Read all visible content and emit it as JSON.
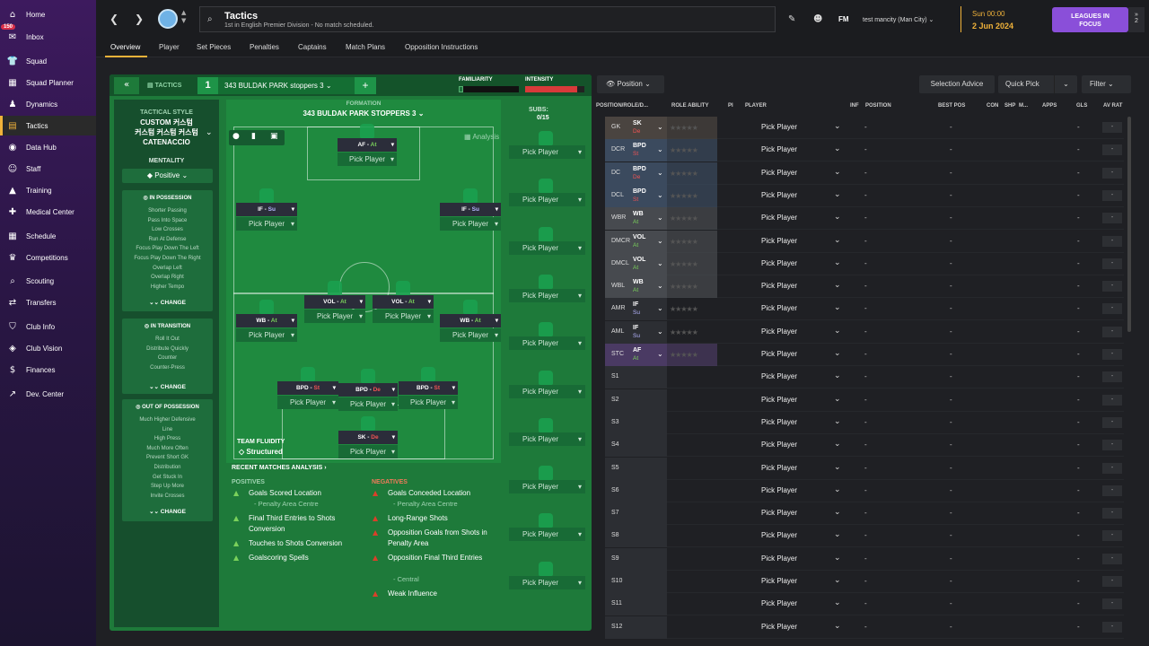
{
  "sidebar": {
    "items": [
      {
        "label": "Home",
        "icon": "home-icon",
        "glyph": "⌂"
      },
      {
        "label": "Inbox",
        "icon": "inbox-icon",
        "glyph": "✉",
        "badge": "150"
      },
      {
        "label": "Squad",
        "icon": "squad-icon",
        "glyph": "👕"
      },
      {
        "label": "Squad Planner",
        "icon": "squad-planner-icon",
        "glyph": "▦"
      },
      {
        "label": "Dynamics",
        "icon": "dynamics-icon",
        "glyph": "♟"
      },
      {
        "label": "Tactics",
        "icon": "tactics-icon",
        "glyph": "▤"
      },
      {
        "label": "Data Hub",
        "icon": "data-hub-icon",
        "glyph": "◉"
      },
      {
        "label": "Staff",
        "icon": "staff-icon",
        "glyph": "☺"
      },
      {
        "label": "Training",
        "icon": "training-icon",
        "glyph": "▲"
      },
      {
        "label": "Medical Center",
        "icon": "medical-icon",
        "glyph": "✚"
      },
      {
        "label": "Schedule",
        "icon": "schedule-icon",
        "glyph": "▦"
      },
      {
        "label": "Competitions",
        "icon": "trophy-icon",
        "glyph": "♛"
      },
      {
        "label": "Scouting",
        "icon": "scouting-icon",
        "glyph": "⌕"
      },
      {
        "label": "Transfers",
        "icon": "transfers-icon",
        "glyph": "⇄"
      },
      {
        "label": "Club Info",
        "icon": "club-info-icon",
        "glyph": "⛉"
      },
      {
        "label": "Club Vision",
        "icon": "club-vision-icon",
        "glyph": "◈"
      },
      {
        "label": "Finances",
        "icon": "finances-icon",
        "glyph": "$"
      },
      {
        "label": "Dev. Center",
        "icon": "dev-center-icon",
        "glyph": "↗"
      }
    ]
  },
  "header": {
    "title": "Tactics",
    "subtitle": "1st in English Premier Division - No match scheduled.",
    "fm_label": "FM",
    "profile": "test mancity (Man City)",
    "date_line1": "Sun 00:00",
    "date_line2": "2 Jun 2024",
    "leagues_btn": "LEAGUES IN FOCUS",
    "leagues_count": "2"
  },
  "tabs": [
    "Overview",
    "Player",
    "Set Pieces",
    "Penalties",
    "Captains",
    "Match Plans",
    "Opposition Instructions"
  ],
  "tactic": {
    "label": "TACTICS",
    "slot": "1",
    "name": "343 BULDAK PARK stoppers 3",
    "familiarity_label": "FAMILIARITY",
    "familiarity_value": 0.08,
    "intensity_label": "INTENSITY",
    "intensity_value": 0.88,
    "formation_label": "FORMATION",
    "formation_name": "343 BULDAK PARK STOPPERS 3",
    "subs_label": "SUBS:",
    "subs_count": "0/15",
    "analysis_label": "Analysis"
  },
  "style": {
    "header": "TACTICAL STYLE",
    "name_line1": "CUSTOM 커스텀",
    "name_line2": "커스텀 커스텀 커스텀",
    "name_line3": "CATENACCIO",
    "mentality_label": "MENTALITY",
    "mentality_value": "Positive",
    "in_possession": {
      "title": "IN POSSESSION",
      "items": [
        "Shorter Passing",
        "Pass Into Space",
        "Low Crosses",
        "Run At Defense",
        "Focus Play Down The Left",
        "Focus Play Down The Right",
        "Overlap Left",
        "Overlap Right",
        "Higher Tempo"
      ],
      "change": "CHANGE"
    },
    "in_transition": {
      "title": "IN TRANSITION",
      "items": [
        "Roll It Out",
        "Distribute Quickly",
        "Counter",
        "Counter-Press"
      ],
      "change": "CHANGE"
    },
    "out_of_possession": {
      "title": "OUT OF POSSESSION",
      "items": [
        "Much Higher Defensive",
        "Line",
        "High Press",
        "Much More Often",
        "Prevent Short GK",
        "Distribution",
        "Get Stuck In",
        "Step Up More",
        "Invite Crosses"
      ],
      "change": "CHANGE"
    }
  },
  "pitch_players": [
    {
      "role": "AF",
      "duty": "At",
      "duty_type": "a",
      "pick": "Pick Player"
    },
    {
      "role": "IF",
      "duty": "Su",
      "duty_type": "s",
      "pick": "Pick Player"
    },
    {
      "role": "IF",
      "duty": "Su",
      "duty_type": "s",
      "pick": "Pick Player"
    },
    {
      "role": "VOL",
      "duty": "At",
      "duty_type": "a",
      "pick": "Pick Player"
    },
    {
      "role": "VOL",
      "duty": "At",
      "duty_type": "a",
      "pick": "Pick Player"
    },
    {
      "role": "WB",
      "duty": "At",
      "duty_type": "a",
      "pick": "Pick Player"
    },
    {
      "role": "WB",
      "duty": "At",
      "duty_type": "a",
      "pick": "Pick Player"
    },
    {
      "role": "BPD",
      "duty": "St",
      "duty_type": "d",
      "pick": "Pick Player"
    },
    {
      "role": "BPD",
      "duty": "De",
      "duty_type": "d",
      "pick": "Pick Player"
    },
    {
      "role": "BPD",
      "duty": "St",
      "duty_type": "d",
      "pick": "Pick Player"
    },
    {
      "role": "SK",
      "duty": "De",
      "duty_type": "d",
      "pick": "Pick Player"
    }
  ],
  "team_fluidity": {
    "label": "TEAM FLUIDITY",
    "value": "Structured"
  },
  "sub_pick_label": "Pick Player",
  "analysis": {
    "header": "RECENT MATCHES ANALYSIS",
    "positives_label": "POSITIVES",
    "negatives_label": "NEGATIVES",
    "positives": [
      {
        "text": "Goals Scored Location",
        "sub": "- Penalty Area Centre"
      },
      {
        "text": "Final Third Entries to Shots Conversion"
      },
      {
        "text": "Touches to Shots Conversion"
      },
      {
        "text": "Goalscoring Spells"
      }
    ],
    "negatives": [
      {
        "text": "Goals Conceded Location",
        "sub": "- Penalty Area Centre"
      },
      {
        "text": "Long-Range Shots"
      },
      {
        "text": "Opposition Goals from Shots in Penalty Area"
      },
      {
        "text": "Opposition Final Third Entries",
        "sub": "- Central"
      },
      {
        "text": "Weak Influence"
      }
    ]
  },
  "right": {
    "position_btn": "Position",
    "selection_advice": "Selection Advice",
    "quick_pick": "Quick Pick",
    "filter": "Filter",
    "columns": [
      "POSITION/ROLE/D...",
      "ROLE ABILITY",
      "PI",
      "PLAYER",
      "INF",
      "POSITION",
      "BEST POS",
      "CON",
      "SHP",
      "M...",
      "APPS",
      "GLS",
      "AV RAT"
    ],
    "pick_label": "Pick Player",
    "dash": "-",
    "rows": [
      {
        "pos": "GK",
        "role": "SK",
        "duty": "De",
        "dtype": "d",
        "bg": "#4a4440"
      },
      {
        "pos": "DCR",
        "role": "BPD",
        "duty": "St",
        "dtype": "d",
        "bg": "#3b4a5e"
      },
      {
        "pos": "DC",
        "role": "BPD",
        "duty": "De",
        "dtype": "d",
        "bg": "#3b4a5e"
      },
      {
        "pos": "DCL",
        "role": "BPD",
        "duty": "St",
        "dtype": "d",
        "bg": "#3b4a5e"
      },
      {
        "pos": "WBR",
        "role": "WB",
        "duty": "At",
        "dtype": "a",
        "bg": "#474a4f"
      },
      {
        "pos": "DMCR",
        "role": "VOL",
        "duty": "At",
        "dtype": "a",
        "bg": "#474a4f"
      },
      {
        "pos": "DMCL",
        "role": "VOL",
        "duty": "At",
        "dtype": "a",
        "bg": "#474a4f"
      },
      {
        "pos": "WBL",
        "role": "WB",
        "duty": "At",
        "dtype": "a",
        "bg": "#474a4f"
      },
      {
        "pos": "AMR",
        "role": "IF",
        "duty": "Su",
        "dtype": "s",
        "bg": "#2c2e33"
      },
      {
        "pos": "AML",
        "role": "IF",
        "duty": "Su",
        "dtype": "s",
        "bg": "#2c2e33"
      },
      {
        "pos": "STC",
        "role": "AF",
        "duty": "At",
        "dtype": "a",
        "bg": "#4a3a63"
      },
      {
        "pos": "S1"
      },
      {
        "pos": "S2"
      },
      {
        "pos": "S3"
      },
      {
        "pos": "S4"
      },
      {
        "pos": "S5"
      },
      {
        "pos": "S6"
      },
      {
        "pos": "S7"
      },
      {
        "pos": "S8"
      },
      {
        "pos": "S9"
      },
      {
        "pos": "S10"
      },
      {
        "pos": "S11"
      },
      {
        "pos": "S12"
      }
    ]
  }
}
